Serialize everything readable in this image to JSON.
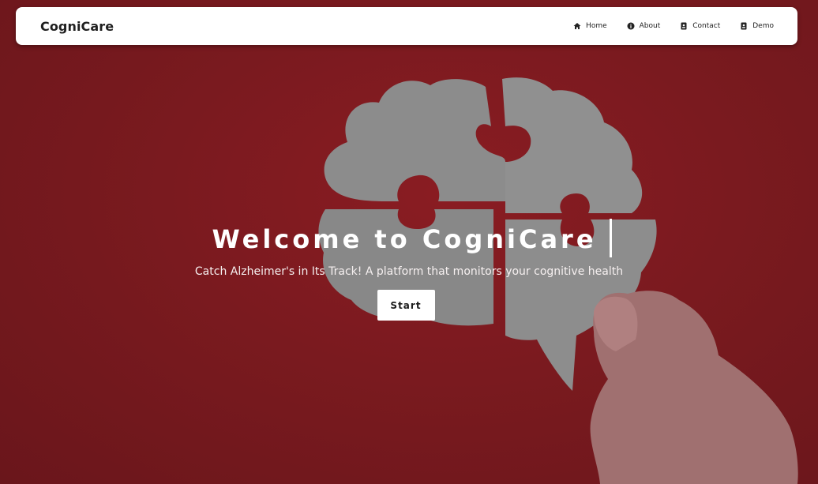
{
  "nav": {
    "brand": "CogniCare",
    "links": [
      {
        "label": "Home",
        "icon": "home-icon"
      },
      {
        "label": "About",
        "icon": "info-icon"
      },
      {
        "label": "Contact",
        "icon": "contact-icon"
      },
      {
        "label": "Demo",
        "icon": "demo-icon"
      }
    ]
  },
  "hero": {
    "title": "Welcome to CogniCare",
    "subtitle": "Catch Alzheimer's in Its Track! A platform that monitors your cognitive health",
    "cta_label": "Start"
  },
  "colors": {
    "background": "#7a1a1f",
    "puzzle": "#8f8f8f",
    "navbar": "#ffffff",
    "button": "#ffffff"
  }
}
